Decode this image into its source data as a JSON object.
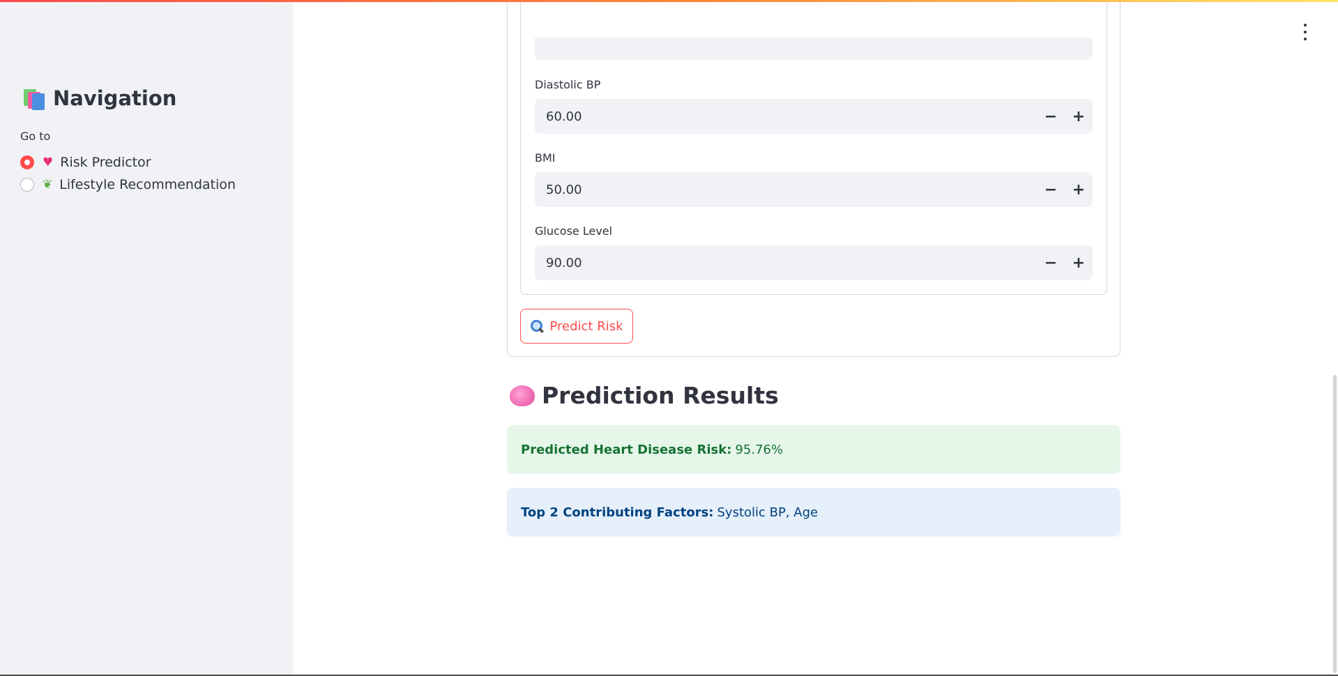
{
  "sidebar": {
    "title": "Navigation",
    "title_icon": "books-icon",
    "radio_label": "Go to",
    "options": [
      {
        "icon": "heart-icon",
        "label": "Risk Predictor",
        "selected": true
      },
      {
        "icon": "herb-icon",
        "label": "Lifestyle Recommendation",
        "selected": false
      }
    ]
  },
  "form": {
    "fields": [
      {
        "label": "Diastolic BP",
        "value": "60.00"
      },
      {
        "label": "BMI",
        "value": "50.00"
      },
      {
        "label": "Glucose Level",
        "value": "90.00"
      }
    ],
    "decrement_symbol": "−",
    "increment_symbol": "+",
    "submit_label": "Predict Risk",
    "submit_icon": "magnifier-icon"
  },
  "results": {
    "title": "Prediction Results",
    "title_icon": "brain-icon",
    "risk_label": "Predicted Heart Disease Risk:",
    "risk_value": "95.76%",
    "factors_label": "Top 2 Contributing Factors:",
    "factors_value": "Systolic BP, Age"
  },
  "colors": {
    "accent": "#ff4b4b",
    "sidebar_bg": "#f0f2f6",
    "success_bg": "#e6f7ea",
    "success_text": "#177233",
    "info_bg": "#e6f0fb",
    "info_text": "#004280"
  }
}
